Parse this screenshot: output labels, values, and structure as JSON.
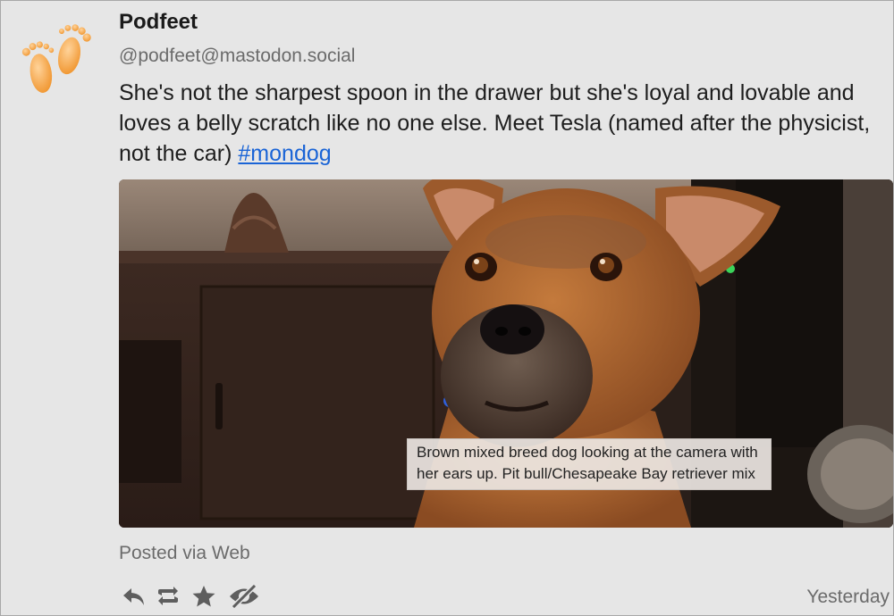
{
  "post": {
    "display_name": "Podfeet",
    "handle": "@podfeet@mastodon.social",
    "text": "She's not the sharpest spoon in the drawer but she's loyal and lovable and loves a belly scratch like no one else. Meet Tesla (named after the physicist, not the car) ",
    "hashtag": "#mondog",
    "media": {
      "alt_text": "Brown mixed breed dog looking at the camera with her ears up. Pit bull/Chesapeake Bay retriever mix"
    },
    "posted_via": "Posted via Web",
    "timestamp": "Yesterday"
  },
  "avatar": {
    "icon": "footprints-icon"
  },
  "actions": [
    {
      "icon": "reply-icon"
    },
    {
      "icon": "boost-icon"
    },
    {
      "icon": "favorite-star-icon"
    },
    {
      "icon": "hide-eye-icon"
    }
  ],
  "colors": {
    "link": "#1a64d6",
    "muted_text": "#6b6b6b",
    "icon": "#5e5e5e",
    "avatar_orange": "#f2a24a"
  }
}
